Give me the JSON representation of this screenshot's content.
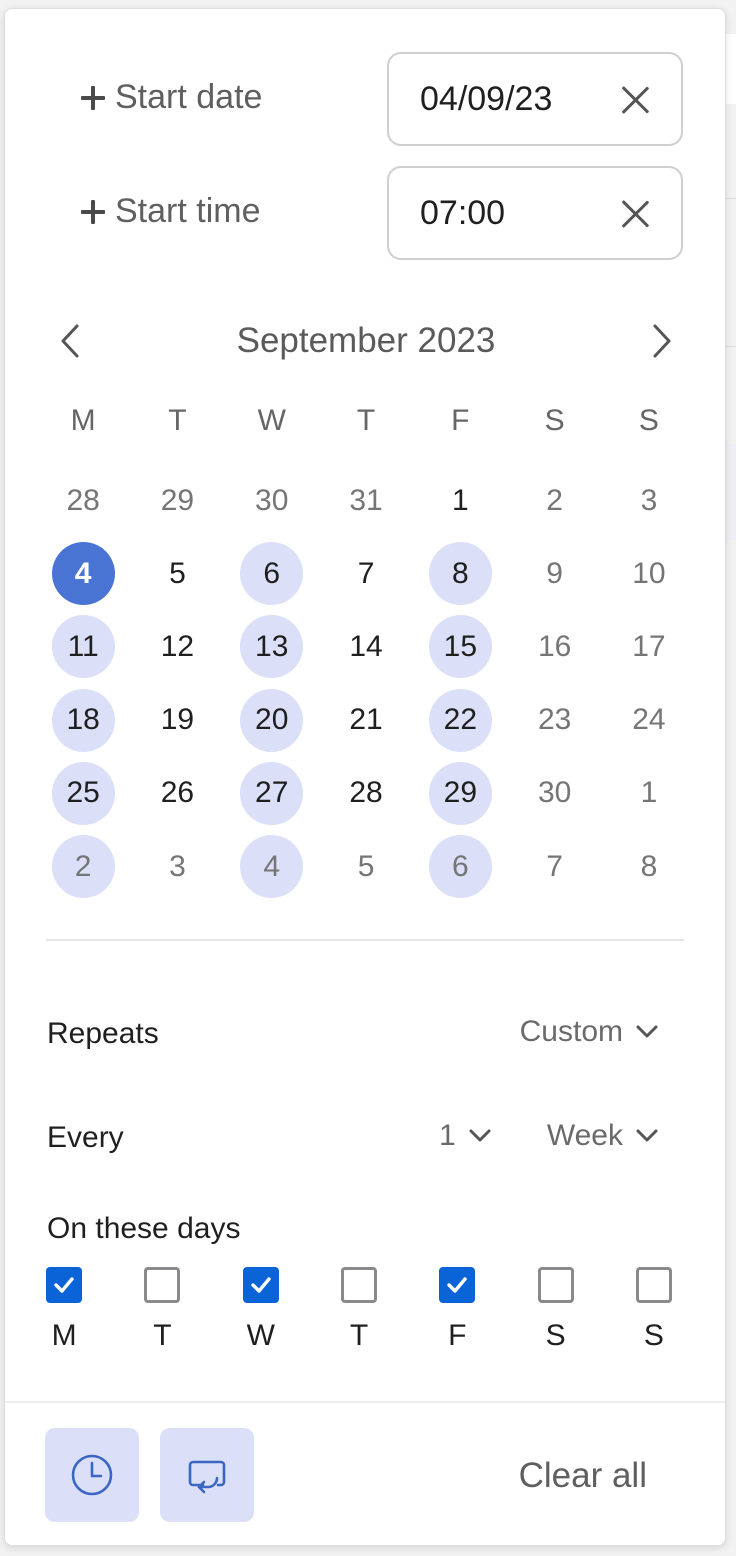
{
  "start_date": {
    "label": "Start date",
    "value": "04/09/23"
  },
  "start_time": {
    "label": "Start time",
    "value": "07:00"
  },
  "calendar": {
    "month_title": "September 2023",
    "weekdays": [
      "M",
      "T",
      "W",
      "T",
      "F",
      "S",
      "S"
    ],
    "days": [
      {
        "d": "28",
        "muted": true,
        "hl": false,
        "sel": false
      },
      {
        "d": "29",
        "muted": true,
        "hl": false,
        "sel": false
      },
      {
        "d": "30",
        "muted": true,
        "hl": false,
        "sel": false
      },
      {
        "d": "31",
        "muted": true,
        "hl": false,
        "sel": false
      },
      {
        "d": "1",
        "muted": false,
        "hl": false,
        "sel": false
      },
      {
        "d": "2",
        "muted": true,
        "hl": false,
        "sel": false
      },
      {
        "d": "3",
        "muted": true,
        "hl": false,
        "sel": false
      },
      {
        "d": "4",
        "muted": false,
        "hl": false,
        "sel": true
      },
      {
        "d": "5",
        "muted": false,
        "hl": false,
        "sel": false
      },
      {
        "d": "6",
        "muted": false,
        "hl": true,
        "sel": false
      },
      {
        "d": "7",
        "muted": false,
        "hl": false,
        "sel": false
      },
      {
        "d": "8",
        "muted": false,
        "hl": true,
        "sel": false
      },
      {
        "d": "9",
        "muted": true,
        "hl": false,
        "sel": false
      },
      {
        "d": "10",
        "muted": true,
        "hl": false,
        "sel": false
      },
      {
        "d": "11",
        "muted": false,
        "hl": true,
        "sel": false
      },
      {
        "d": "12",
        "muted": false,
        "hl": false,
        "sel": false
      },
      {
        "d": "13",
        "muted": false,
        "hl": true,
        "sel": false
      },
      {
        "d": "14",
        "muted": false,
        "hl": false,
        "sel": false
      },
      {
        "d": "15",
        "muted": false,
        "hl": true,
        "sel": false
      },
      {
        "d": "16",
        "muted": true,
        "hl": false,
        "sel": false
      },
      {
        "d": "17",
        "muted": true,
        "hl": false,
        "sel": false
      },
      {
        "d": "18",
        "muted": false,
        "hl": true,
        "sel": false
      },
      {
        "d": "19",
        "muted": false,
        "hl": false,
        "sel": false
      },
      {
        "d": "20",
        "muted": false,
        "hl": true,
        "sel": false
      },
      {
        "d": "21",
        "muted": false,
        "hl": false,
        "sel": false
      },
      {
        "d": "22",
        "muted": false,
        "hl": true,
        "sel": false
      },
      {
        "d": "23",
        "muted": true,
        "hl": false,
        "sel": false
      },
      {
        "d": "24",
        "muted": true,
        "hl": false,
        "sel": false
      },
      {
        "d": "25",
        "muted": false,
        "hl": true,
        "sel": false
      },
      {
        "d": "26",
        "muted": false,
        "hl": false,
        "sel": false
      },
      {
        "d": "27",
        "muted": false,
        "hl": true,
        "sel": false
      },
      {
        "d": "28",
        "muted": false,
        "hl": false,
        "sel": false
      },
      {
        "d": "29",
        "muted": false,
        "hl": true,
        "sel": false
      },
      {
        "d": "30",
        "muted": true,
        "hl": false,
        "sel": false
      },
      {
        "d": "1",
        "muted": true,
        "hl": false,
        "sel": false
      },
      {
        "d": "2",
        "muted": true,
        "hl": true,
        "sel": false
      },
      {
        "d": "3",
        "muted": true,
        "hl": false,
        "sel": false
      },
      {
        "d": "4",
        "muted": true,
        "hl": true,
        "sel": false
      },
      {
        "d": "5",
        "muted": true,
        "hl": false,
        "sel": false
      },
      {
        "d": "6",
        "muted": true,
        "hl": true,
        "sel": false
      },
      {
        "d": "7",
        "muted": true,
        "hl": false,
        "sel": false
      },
      {
        "d": "8",
        "muted": true,
        "hl": false,
        "sel": false
      }
    ]
  },
  "repeat": {
    "repeats_label": "Repeats",
    "repeats_value": "Custom",
    "every_label": "Every",
    "every_count": "1",
    "every_unit": "Week"
  },
  "on_days": {
    "label": "On these days",
    "days": [
      {
        "d": "M",
        "checked": true
      },
      {
        "d": "T",
        "checked": false
      },
      {
        "d": "W",
        "checked": true
      },
      {
        "d": "T",
        "checked": false
      },
      {
        "d": "F",
        "checked": true
      },
      {
        "d": "S",
        "checked": false
      },
      {
        "d": "S",
        "checked": false
      }
    ]
  },
  "footer": {
    "clear_all": "Clear all"
  },
  "colors": {
    "accent": "#4a74d4",
    "highlight": "#dbdff7",
    "checkbox_on": "#0b63d8"
  },
  "icons": {
    "clock_button": "clock-icon",
    "repeat_button": "repeat-screen-icon"
  }
}
